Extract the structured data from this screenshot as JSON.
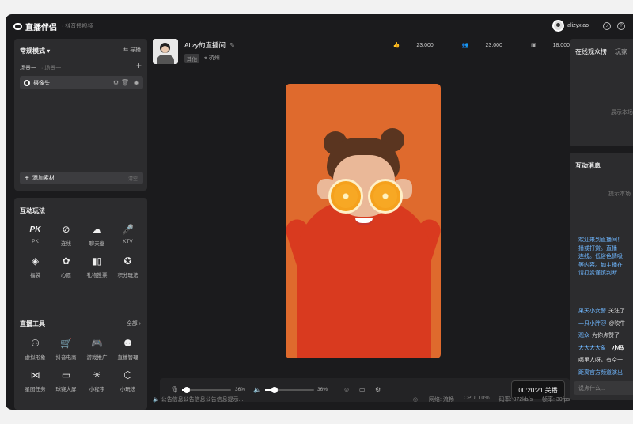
{
  "app": {
    "title": "直播伴侣",
    "subtitle": "· 抖音短视频",
    "username": "alizyxiao"
  },
  "scene_panel": {
    "mode_label": "常规模式",
    "guide_label": "导播",
    "scene_tab_active": "场景一",
    "scene_tab_other": "· 场景一",
    "camera_label": "摄像头",
    "add_material_label": "添加素材",
    "clear_label": "清空"
  },
  "interactive": {
    "title": "互动玩法",
    "items": [
      {
        "label": "PK",
        "icon": "pk-icon"
      },
      {
        "label": "连线",
        "icon": "link-icon"
      },
      {
        "label": "聊天室",
        "icon": "chatroom-icon"
      },
      {
        "label": "KTV",
        "icon": "microphone-icon"
      },
      {
        "label": "福袋",
        "icon": "lucky-bag-icon"
      },
      {
        "label": "心愿",
        "icon": "wish-icon"
      },
      {
        "label": "礼物投票",
        "icon": "vote-chart-icon"
      },
      {
        "label": "积分玩法",
        "icon": "points-icon"
      }
    ]
  },
  "tools": {
    "title": "直播工具",
    "all_label": "全部",
    "items": [
      {
        "label": "虚拟形象",
        "icon": "avatar-icon"
      },
      {
        "label": "抖音电商",
        "icon": "cart-icon"
      },
      {
        "label": "游戏推广",
        "icon": "gamepad-icon"
      },
      {
        "label": "直播管理",
        "icon": "manage-icon"
      },
      {
        "label": "星图任务",
        "icon": "star-map-icon"
      },
      {
        "label": "球赛大屏",
        "icon": "screen-icon"
      },
      {
        "label": "小程序",
        "icon": "mini-program-icon"
      },
      {
        "label": "小玩法",
        "icon": "mini-game-icon"
      }
    ]
  },
  "room": {
    "name": "Alizy的直播间",
    "tag": "其他",
    "location": "杭州",
    "likes": "23,000",
    "viewers": "23,000",
    "followers": "18,000"
  },
  "controls": {
    "mic_volume_pct": 0.09,
    "mic_volume_label": "36%",
    "speaker_volume_pct": 0.2,
    "speaker_volume_label": "36%",
    "timer": "00:20:21 关播"
  },
  "status": {
    "announcement": "公告信息公告信息公告信息提示...",
    "network": "网络: 流畅",
    "cpu": "CPU: 10%",
    "bitrate": "码率: 872kb/s",
    "fps": "帧率: 30fps"
  },
  "audience": {
    "tab_active": "在线观众榜",
    "tab_other": "玩家",
    "empty_text": "展示本场"
  },
  "messages": {
    "title": "互动消息",
    "empty_text": "提示本场",
    "welcome_lines": [
      "欢迎来到直播间！",
      "播或打赏。直播",
      "连线。低俗色情吸",
      "等内容。如主播在",
      "请打赏谨慎判断"
    ],
    "items": [
      {
        "user": "果天小女警",
        "text": "关注了"
      },
      {
        "user": "一只小胖🐱",
        "text": "@吹牛"
      },
      {
        "user": "观众",
        "text": "为你点赞了"
      },
      {
        "user": "大大大大象",
        "text": "小蚂",
        "bold": true
      },
      {
        "user": "",
        "text": "哪里人呀，有空一"
      },
      {
        "user": "距离官方频道演出",
        "text": ""
      }
    ],
    "input_placeholder": "说点什么..."
  },
  "colors": {
    "accent_blue": "#6fb7ff",
    "video_background": "#df6a2d",
    "panel": "#2c2c2e"
  }
}
